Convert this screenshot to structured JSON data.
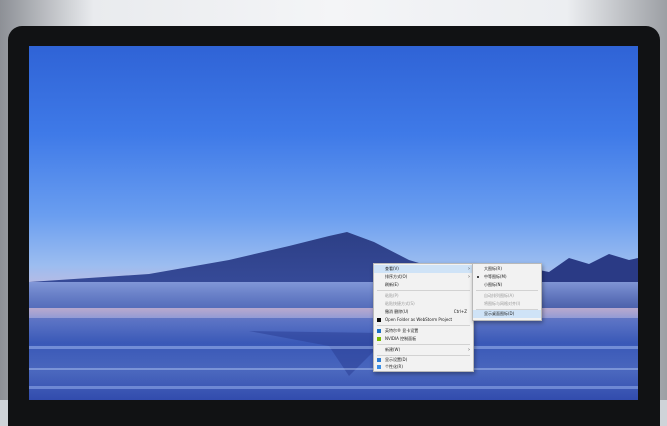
{
  "menu": {
    "items": [
      {
        "label": "查看(V)",
        "has_submenu": true,
        "highlighted": true
      },
      {
        "label": "排序方式(O)",
        "has_submenu": true
      },
      {
        "label": "刷新(E)"
      },
      {
        "label": "粘贴(P)",
        "disabled": true
      },
      {
        "label": "粘贴快捷方式(S)",
        "disabled": true
      },
      {
        "label": "撤消 删除(U)",
        "shortcut": "Ctrl+Z"
      },
      {
        "label": "Open Folder as WebStorm Project",
        "icon": "webstorm-icon"
      },
      {
        "label": "英特尔® 显卡设置",
        "icon": "intel-graphics-icon"
      },
      {
        "label": "NVIDIA 控制面板",
        "icon": "nvidia-icon"
      },
      {
        "label": "新建(W)",
        "has_submenu": true
      },
      {
        "label": "显示设置(D)",
        "icon": "display-settings-icon"
      },
      {
        "label": "个性化(R)",
        "icon": "personalize-icon"
      }
    ]
  },
  "submenu": {
    "items": [
      {
        "label": "大图标(R)"
      },
      {
        "label": "中等图标(M)",
        "selected": true
      },
      {
        "label": "小图标(N)"
      },
      {
        "label": "自动排列图标(A)",
        "disabled": true
      },
      {
        "label": "将图标与网格对齐(I)",
        "disabled": true
      },
      {
        "label": "显示桌面图标(D)",
        "highlighted": true
      }
    ]
  },
  "colors": {
    "menu_bg": "#f2f2f2",
    "highlight": "#cfe3f7"
  }
}
